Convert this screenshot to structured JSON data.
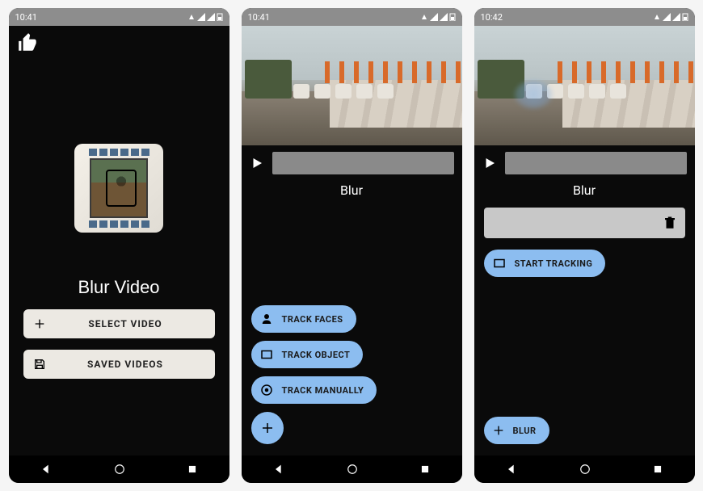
{
  "status": {
    "time1": "10:41",
    "time2": "10:41",
    "time3": "10:42"
  },
  "screen1": {
    "title": "Blur Video",
    "select_label": "SELECT VIDEO",
    "saved_label": "SAVED VIDEOS"
  },
  "screen2": {
    "mode_label": "Blur",
    "track_faces": "TRACK FACES",
    "track_object": "TRACK OBJECT",
    "track_manually": "TRACK MANUALLY"
  },
  "screen3": {
    "mode_label": "Blur",
    "start_tracking": "START TRACKING",
    "blur_label": "BLUR"
  }
}
